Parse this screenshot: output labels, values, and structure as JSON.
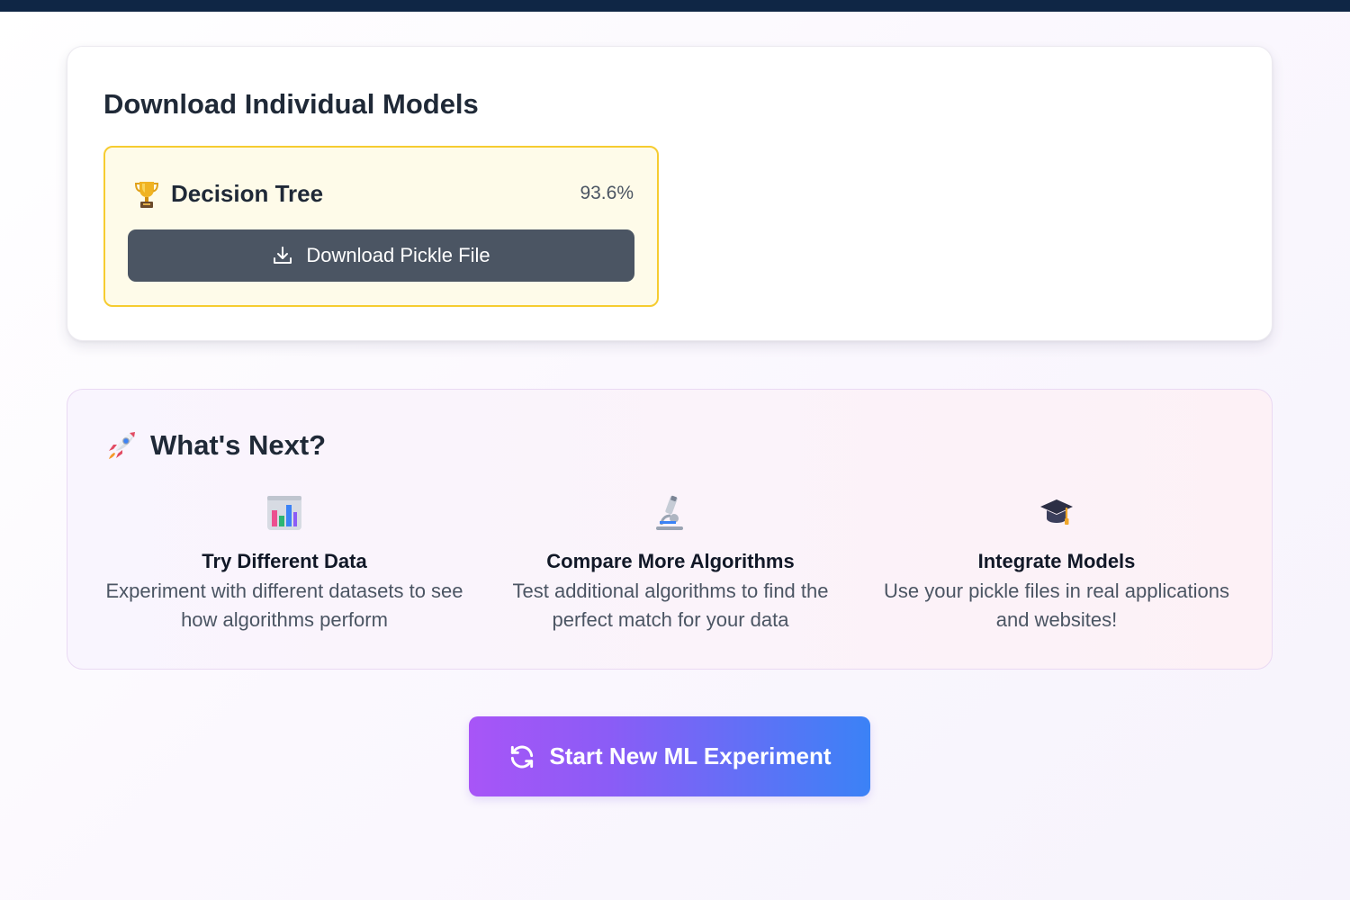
{
  "download_section": {
    "title": "Download Individual Models",
    "models": [
      {
        "name": "Decision Tree",
        "score": "93.6%",
        "icon": "trophy-icon",
        "download_label": "Download Pickle File"
      }
    ]
  },
  "next_section": {
    "title": "What's Next?",
    "icon": "rocket-icon",
    "features": [
      {
        "icon": "bar-chart-icon",
        "title": "Try Different Data",
        "description": "Experiment with different datasets to see how algorithms perform"
      },
      {
        "icon": "microscope-icon",
        "title": "Compare More Algorithms",
        "description": "Test additional algorithms to find the perfect match for your data"
      },
      {
        "icon": "graduation-cap-icon",
        "title": "Integrate Models",
        "description": "Use your pickle files in real applications and websites!"
      }
    ]
  },
  "cta": {
    "label": "Start New ML Experiment",
    "icon": "refresh-icon"
  },
  "colors": {
    "top_bar": "#0f2645",
    "model_card_border": "#f6cc30",
    "download_button": "#4b5563",
    "cta_gradient_start": "#a855f7",
    "cta_gradient_end": "#3b82f6"
  }
}
